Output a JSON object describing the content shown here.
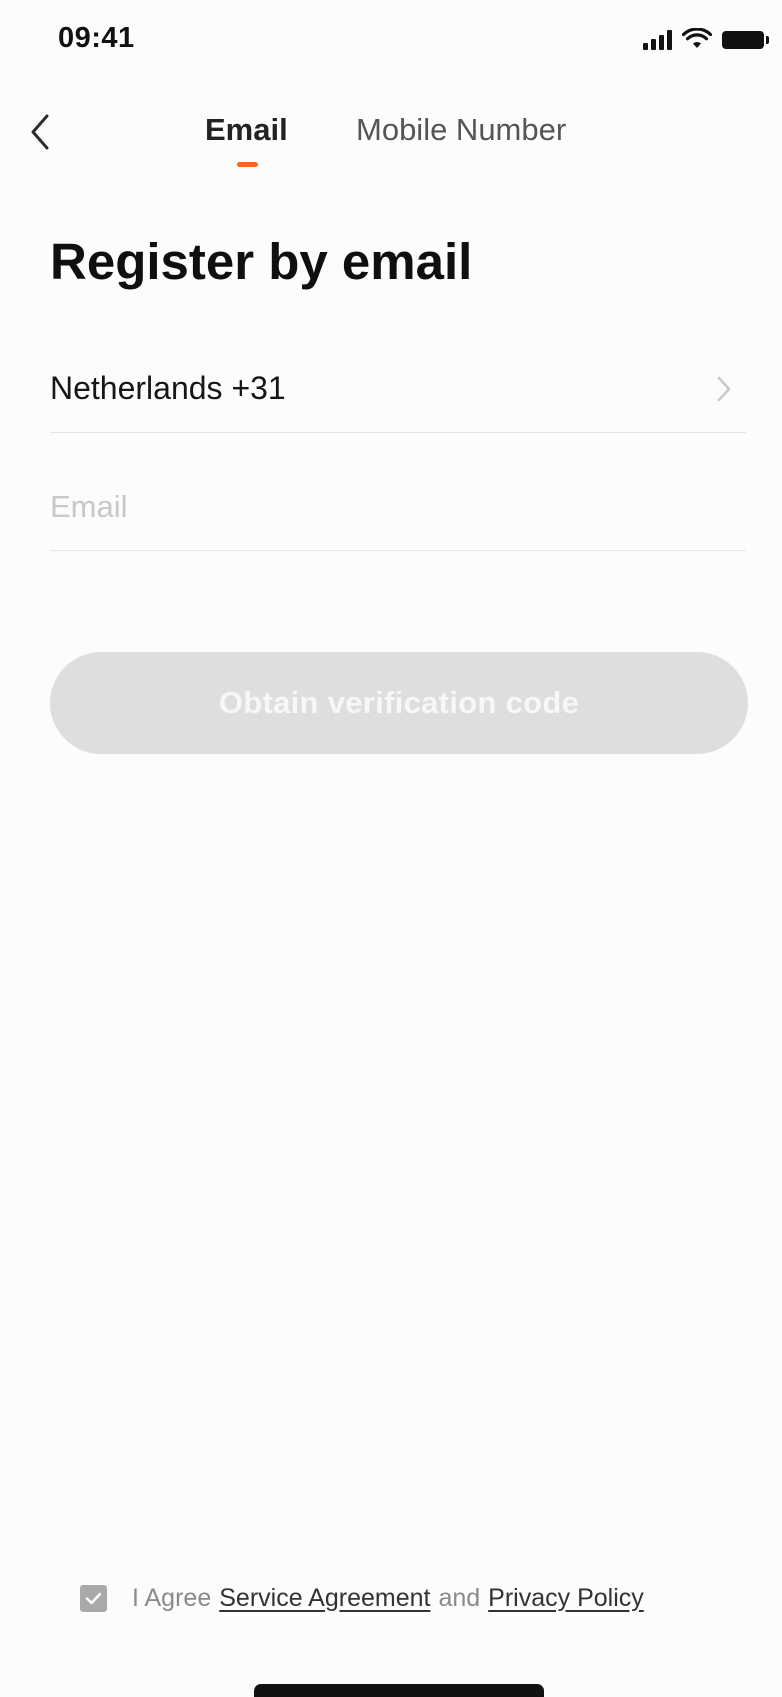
{
  "status_bar": {
    "time": "09:41",
    "icons": [
      "signal-icon",
      "wifi-icon",
      "battery-icon"
    ]
  },
  "nav": {
    "back_icon": "chevron-left-icon",
    "tabs": [
      {
        "label": "Email",
        "active": true
      },
      {
        "label": "Mobile Number",
        "active": false
      }
    ]
  },
  "page": {
    "title": "Register by email"
  },
  "form": {
    "country": {
      "label": "Netherlands +31",
      "icon": "chevron-right-icon"
    },
    "email": {
      "value": "",
      "placeholder": "Email"
    },
    "submit_label": "Obtain verification code"
  },
  "agreement": {
    "checked": true,
    "prefix": "I Agree",
    "service_link": "Service Agreement",
    "conjunction": "and",
    "privacy_link": "Privacy Policy"
  },
  "colors": {
    "accent": "#f26a1b",
    "background": "#fcfcfc",
    "button_disabled": "#dedede",
    "divider": "#e5e5e5",
    "checkbox": "#a9a9a9"
  }
}
